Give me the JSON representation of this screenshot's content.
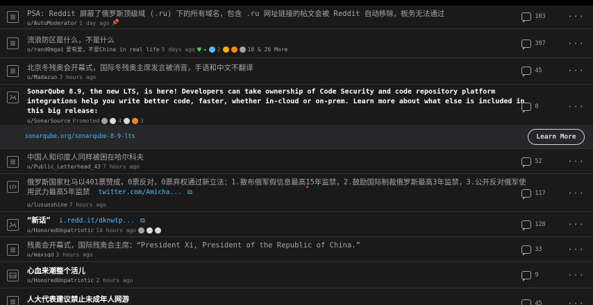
{
  "posts": [
    {
      "title": "PSA: Reddit 屏蔽了俄罗斯顶级域 (.ru) 下的所有域名，包含 .ru 网址链接的帖文会被 Reddit 自动移除，板务无法通过",
      "user": "u/AutoModerator",
      "time": "1 day ago",
      "comments": "103"
    },
    {
      "title": "流浪防区是什么，不是什么",
      "user": "u/rand0mgai",
      "flair": "爱有爱，不爱China in real life",
      "time": "5 days ago",
      "awards_text": "2",
      "more": "10 & 26 More",
      "comments": "397"
    },
    {
      "title": "北京冬残奥会开幕式，国际冬残奥主席发言被消音，手语和中文不翻译",
      "user": "u/Madazuo",
      "time": "3 hours ago",
      "comments": "45"
    },
    {
      "title": "SonarQube 8.9, the new LTS, is here! Developers can take ownership of Code Security and code repository platform integrations help you write better code, faster, whether in-cloud or on-prem. Learn more about what else is included in this big release:",
      "user": "u/SonarSource",
      "promoted": "Promoted",
      "award_a": "4",
      "award_b": "3",
      "comments": "0",
      "ad_domain": "sonarqube.org/sonarqube-8-9-lts",
      "ad_button": "Learn More"
    },
    {
      "title": "中国人和印度人同样被困在哈尔科夫",
      "user": "u/Public_Letterhead_43",
      "time": "7 hours ago",
      "comments": "52"
    },
    {
      "title": "俄罗斯国家杜马以401票赞成，0票反对，0票弃权通过新立法：1.散布俄军假信息最高15年监禁，2.鼓励国际制裁俄罗斯最高3年监禁，3.公开反对俄军使用武力最高5年监禁",
      "link": "twitter.com/Amicha...",
      "user": "u/lusunshine",
      "time": "7 hours ago",
      "comments": "117"
    },
    {
      "title": "“新话”",
      "link": "i.redd.it/dknwtp...",
      "user": "u/HonoredUnpatriotic",
      "time": "14 hours ago",
      "comments": "128"
    },
    {
      "title": "残奥会开幕式，国际残奥会主席：“President Xi, President of the Republic of China.”",
      "user": "u/maxsqd",
      "time": "3 hours ago",
      "comments": "33"
    },
    {
      "title": "心血来潮整个活儿",
      "user": "u/HonoredUnpatriotic",
      "time": "2 hours ago",
      "comments": "9"
    },
    {
      "title": "人大代表建议禁止未成年人网游",
      "comments": "45"
    }
  ],
  "icons": {
    "text": "text-post-icon",
    "link": "link-post-icon",
    "image": "image-post-icon",
    "embed": "embed-post-icon",
    "comment": "comment-bubble-icon",
    "more": "more-options-icon"
  },
  "colors": {
    "background": "#1a1a1b",
    "link": "#4fbcff",
    "meta": "#818384"
  }
}
